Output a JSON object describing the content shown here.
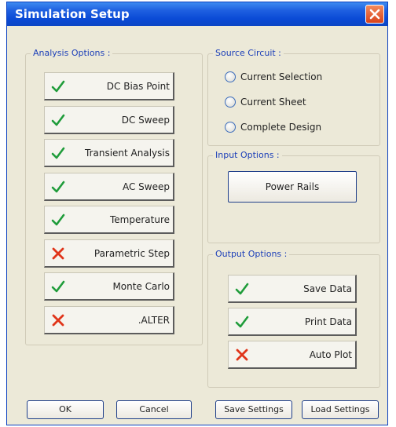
{
  "window": {
    "title": "Simulation Setup"
  },
  "analysis_options": {
    "label": "Analysis Options :",
    "items": [
      {
        "label": "DC Bias Point",
        "enabled": true
      },
      {
        "label": "DC Sweep",
        "enabled": true
      },
      {
        "label": "Transient Analysis",
        "enabled": true
      },
      {
        "label": "AC Sweep",
        "enabled": true
      },
      {
        "label": "Temperature",
        "enabled": true
      },
      {
        "label": "Parametric Step",
        "enabled": false
      },
      {
        "label": "Monte Carlo",
        "enabled": true
      },
      {
        "label": ".ALTER",
        "enabled": false
      }
    ]
  },
  "source_circuit": {
    "label": "Source Circuit :",
    "options": [
      {
        "label": "Current Selection",
        "selected": false
      },
      {
        "label": "Current Sheet",
        "selected": false
      },
      {
        "label": "Complete Design",
        "selected": false
      }
    ]
  },
  "input_options": {
    "label": "Input Options :",
    "power_rails_label": "Power Rails"
  },
  "output_options": {
    "label": "Output Options :",
    "items": [
      {
        "label": "Save Data",
        "enabled": true
      },
      {
        "label": "Print Data",
        "enabled": true
      },
      {
        "label": "Auto Plot",
        "enabled": false
      }
    ]
  },
  "footer": {
    "ok_label": "OK",
    "cancel_label": "Cancel",
    "save_settings_label": "Save Settings",
    "load_settings_label": "Load Settings"
  },
  "colors": {
    "check": "#1f9c3a",
    "cross": "#e0351a",
    "title_bar": "#0a4ad6",
    "group_label": "#1c3fb8"
  },
  "icons": {
    "enabled": "check-icon",
    "disabled": "cross-icon"
  }
}
